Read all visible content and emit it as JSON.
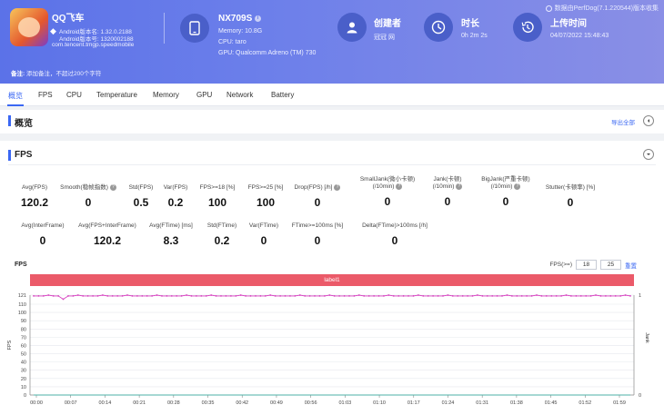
{
  "header": {
    "perfdog_note": "数据由PerfDog(7.1.220544)版本收集",
    "app": {
      "name": "QQ飞车",
      "android_version": "Android版本名: 1.32.0.2188",
      "android_code": "Android版本号: 1320002188",
      "package": "com.tencent.tmgp.speedmobile"
    },
    "device": {
      "name": "NX709S",
      "memory": "Memory: 10.8G",
      "cpu": "CPU: taro",
      "gpu": "GPU: Qualcomm Adreno (TM) 730"
    },
    "creator": {
      "title": "创建者",
      "value": "冠冠 网"
    },
    "duration": {
      "title": "时长",
      "value": "0h 2m 2s"
    },
    "upload": {
      "title": "上传时间",
      "value": "04/07/2022 15:48:43"
    },
    "remark_label": "备注:",
    "remark_placeholder": "添加备注，不超过200个字符"
  },
  "tabs": [
    "概览",
    "FPS",
    "CPU",
    "Temperature",
    "Memory",
    "GPU",
    "Network",
    "Battery"
  ],
  "overview": {
    "title": "概览",
    "export_label": "导出全部"
  },
  "fps_section": {
    "title": "FPS",
    "metrics_row1": [
      {
        "label": "Avg(FPS)",
        "label2": "",
        "value": "120.2",
        "help": false
      },
      {
        "label": "Smooth(稳帧指数)",
        "label2": "",
        "value": "0",
        "help": true
      },
      {
        "label": "Std(FPS)",
        "label2": "",
        "value": "0.5",
        "help": false
      },
      {
        "label": "Var(FPS)",
        "label2": "",
        "value": "0.2",
        "help": false
      },
      {
        "label": "FPS>=18 [%]",
        "label2": "",
        "value": "100",
        "help": false
      },
      {
        "label": "FPS>=25 [%]",
        "label2": "",
        "value": "100",
        "help": false
      },
      {
        "label": "Drop(FPS) [/h]",
        "label2": "",
        "value": "0",
        "help": true
      },
      {
        "label": "SmallJank(微小卡顿)",
        "label2": "(/10min)",
        "value": "0",
        "help": true
      },
      {
        "label": "Jank(卡顿)",
        "label2": "(/10min)",
        "value": "0",
        "help": true
      },
      {
        "label": "BigJank(严重卡顿)",
        "label2": "(/10min)",
        "value": "0",
        "help": true
      },
      {
        "label": "Stutter(卡顿率) [%]",
        "label2": "",
        "value": "0",
        "help": false
      }
    ],
    "metrics_row2": [
      {
        "label": "Avg(InterFrame)",
        "value": "0"
      },
      {
        "label": "Avg(FPS+InterFrame)",
        "value": "120.2"
      },
      {
        "label": "Avg(FTime) [ms]",
        "value": "8.3"
      },
      {
        "label": "Std(FTime)",
        "value": "0.2"
      },
      {
        "label": "Var(FTime)",
        "value": "0"
      },
      {
        "label": "FTime>=100ms [%]",
        "value": "0"
      },
      {
        "label": "Delta(FTime)>100ms [/h]",
        "value": "0"
      }
    ]
  },
  "chart_controls": {
    "title": "FPS",
    "fps_label": "FPS(>=)",
    "fps_low": "18",
    "fps_high": "25",
    "reset_label": "重置"
  },
  "colors": {
    "accent": "#3a67f3",
    "fps_line": "#d63fbf",
    "jank_line": "#2fb7a8",
    "label_band": "#eb5a69"
  },
  "chart_data": {
    "type": "line",
    "title": "",
    "band_label": "label1",
    "xlabel": "",
    "ylabel": "FPS",
    "y2label": "Jank",
    "ylim": [
      0,
      121
    ],
    "yticks": [
      0,
      10,
      20,
      30,
      40,
      50,
      60,
      70,
      80,
      90,
      100,
      110,
      121
    ],
    "y2lim": [
      0,
      1
    ],
    "y2ticks": [
      0,
      1
    ],
    "xticks": [
      "00:00",
      "00:07",
      "00:14",
      "00:21",
      "00:28",
      "00:35",
      "00:42",
      "00:49",
      "00:56",
      "01:03",
      "01:10",
      "01:17",
      "01:24",
      "01:31",
      "01:38",
      "01:45",
      "01:52",
      "01:59"
    ],
    "grid": true,
    "series": [
      {
        "name": "FPS",
        "axis": "left",
        "values": [
          120,
          120,
          120,
          121,
          120,
          120,
          116,
          120,
          120,
          121,
          120,
          120,
          120,
          120,
          121,
          120,
          120,
          120,
          120,
          121,
          120,
          120,
          120,
          120,
          120,
          121,
          120,
          120,
          120,
          120,
          120,
          121,
          120,
          120,
          120,
          120,
          121,
          120,
          120,
          120,
          120,
          120,
          121,
          120,
          120,
          120,
          120,
          120,
          121,
          120,
          120,
          120,
          120,
          120,
          121,
          120,
          120,
          120,
          120,
          120,
          121,
          120,
          120,
          120,
          120,
          120,
          121,
          120,
          120,
          120,
          120,
          120,
          121,
          120,
          120,
          120,
          120,
          120,
          121,
          120,
          120,
          120,
          120,
          120,
          121,
          120,
          120,
          120,
          120,
          120,
          121,
          120,
          120,
          120,
          120,
          120,
          121,
          120,
          120,
          120,
          120,
          120,
          121,
          120,
          120,
          120,
          120,
          120,
          121,
          120,
          120,
          120,
          120,
          120,
          121,
          120,
          120,
          120,
          120,
          120,
          121,
          120
        ]
      },
      {
        "name": "Jank",
        "axis": "right",
        "values": [
          0,
          0,
          0,
          0,
          0,
          0,
          0,
          0,
          0,
          0,
          0,
          0,
          0,
          0,
          0,
          0,
          0,
          0,
          0,
          0,
          0,
          0,
          0,
          0,
          0,
          0,
          0,
          0,
          0,
          0,
          0,
          0,
          0,
          0,
          0,
          0,
          0,
          0,
          0,
          0,
          0,
          0,
          0,
          0,
          0,
          0,
          0,
          0,
          0,
          0,
          0,
          0,
          0,
          0,
          0,
          0,
          0,
          0,
          0,
          0,
          0,
          0,
          0,
          0,
          0,
          0,
          0,
          0,
          0,
          0,
          0,
          0,
          0,
          0,
          0,
          0,
          0,
          0,
          0,
          0,
          0,
          0,
          0,
          0,
          0,
          0,
          0,
          0,
          0,
          0,
          0,
          0,
          0,
          0,
          0,
          0,
          0,
          0,
          0,
          0,
          0,
          0,
          0,
          0,
          0,
          0,
          0,
          0,
          0,
          0,
          0,
          0,
          0,
          0,
          0,
          0,
          0,
          0,
          0,
          0,
          0,
          0
        ]
      }
    ]
  }
}
